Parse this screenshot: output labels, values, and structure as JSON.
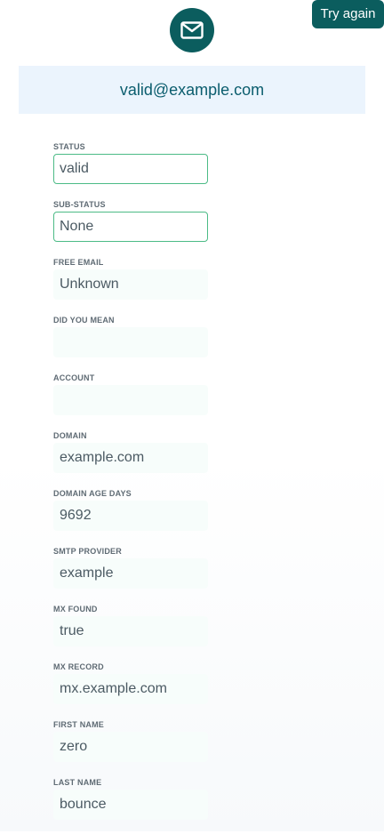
{
  "header": {
    "try_again_label": "Try again",
    "icon": "mail-icon",
    "email": "valid@example.com"
  },
  "colors": {
    "accent": "#0b5d5e",
    "banner_bg": "#ebf4fd",
    "field_border": "#4cbb86"
  },
  "fields": [
    {
      "label": "STATUS",
      "value": "valid"
    },
    {
      "label": "SUB-STATUS",
      "value": "None"
    },
    {
      "label": "FREE EMAIL",
      "value": "Unknown"
    },
    {
      "label": "DID YOU MEAN",
      "value": ""
    },
    {
      "label": "ACCOUNT",
      "value": ""
    },
    {
      "label": "DOMAIN",
      "value": "example.com"
    },
    {
      "label": "DOMAIN AGE DAYS",
      "value": "9692"
    },
    {
      "label": "SMTP PROVIDER",
      "value": "example"
    },
    {
      "label": "MX FOUND",
      "value": "true"
    },
    {
      "label": "MX RECORD",
      "value": "mx.example.com"
    },
    {
      "label": "FIRST NAME",
      "value": "zero"
    },
    {
      "label": "LAST NAME",
      "value": "bounce"
    }
  ]
}
